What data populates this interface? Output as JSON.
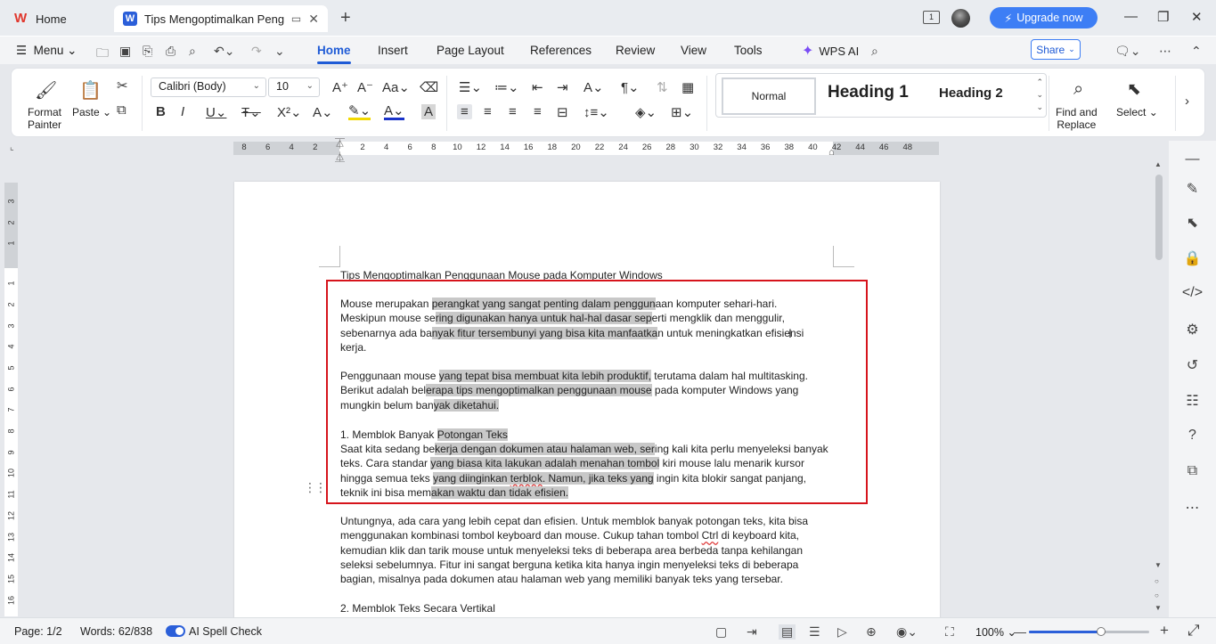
{
  "tabs": {
    "home_label": "Home",
    "doc_label": "Tips Mengoptimalkan Penggunaan"
  },
  "titlebar": {
    "upgrade_label": "Upgrade now"
  },
  "menubar": {
    "menu_label": "Menu",
    "items": [
      "Home",
      "Insert",
      "Page Layout",
      "References",
      "Review",
      "View",
      "Tools"
    ],
    "wps_ai_label": "WPS AI",
    "share_label": "Share"
  },
  "ribbon": {
    "format_painter_label": "Format\nPainter",
    "paste_label": "Paste",
    "font_name": "Calibri (Body)",
    "font_size": "10",
    "styles": {
      "normal": "Normal",
      "heading1": "Heading 1",
      "heading2": "Heading 2"
    },
    "find_replace_label": "Find and\nReplace",
    "select_label": "Select"
  },
  "ruler": {
    "h_ticks": [
      "8",
      "6",
      "4",
      "2",
      "2",
      "4",
      "6",
      "8",
      "10",
      "12",
      "14",
      "16",
      "18",
      "20",
      "22",
      "24",
      "26",
      "28",
      "30",
      "32",
      "34",
      "36",
      "38",
      "40",
      "42",
      "44",
      "46",
      "48"
    ],
    "v_ticks": [
      "3",
      "2",
      "1",
      "1",
      "2",
      "3",
      "4",
      "5",
      "6",
      "7",
      "8",
      "9",
      "10",
      "11",
      "12",
      "13",
      "14",
      "15",
      "16"
    ]
  },
  "document": {
    "title": "Tips Mengoptimalkan Penggunaan Mouse pada Komputer Windows",
    "p1": [
      "Mouse merupakan perangkat yang sangat penting dalam penggunaan komputer sehari-hari.",
      "Meskipun mouse sering digunakan hanya untuk hal-hal dasar seperti mengklik dan menggulir,",
      "sebenarnya ada banyak fitur tersembunyi yang bisa kita manfaatkan untuk meningkatkan efisiensi",
      "kerja."
    ],
    "p2": [
      "Penggunaan mouse yang tepat bisa membuat kita lebih produktif, terutama dalam hal multitasking.",
      "Berikut adalah beberapa tips mengoptimalkan penggunaan mouse pada komputer Windows yang",
      "mungkin belum banyak diketahui."
    ],
    "h1": "1. Memblok Banyak Potongan Teks",
    "p3": [
      "Saat kita sedang bekerja dengan dokumen atau halaman web, sering kali kita perlu menyeleksi banyak",
      "teks. Cara standar yang biasa kita lakukan adalah menahan tombol kiri mouse lalu menarik kursor",
      "hingga semua teks yang diinginkan terblok. Namun, jika teks yang ingin kita blokir sangat panjang,",
      "teknik ini bisa memakan waktu dan tidak efisien."
    ],
    "p4": [
      "Untungnya, ada cara yang lebih cepat dan efisien. Untuk memblok banyak potongan teks, kita bisa",
      "menggunakan kombinasi tombol keyboard dan mouse. Cukup tahan tombol Ctrl di keyboard kita,",
      "kemudian klik dan tarik mouse untuk menyeleksi teks di beberapa area berbeda tanpa kehilangan",
      "seleksi sebelumnya. Fitur ini sangat berguna ketika kita hanya ingin menyeleksi teks di beberapa",
      "bagian, misalnya pada dokumen atau halaman web yang memiliki banyak teks yang tersebar."
    ],
    "h2": "2. Memblok Teks Secara Vertikal"
  },
  "statusbar": {
    "page": "Page: 1/2",
    "words": "Words: 62/838",
    "spell": "AI Spell Check",
    "zoom": "100%",
    "zoom_level": 0.6
  },
  "colors": {
    "accent": "#1f5bd6",
    "highlight_box": "#d6141c",
    "selection": "#c8c8c8"
  }
}
